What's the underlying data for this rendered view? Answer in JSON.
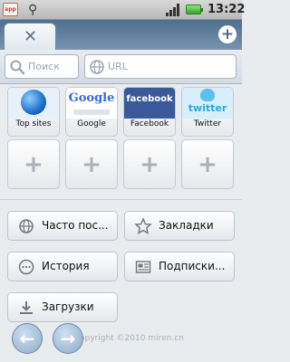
{
  "status_bar": {
    "app_icon_text": "app",
    "time": "13:22"
  },
  "tabs": {
    "close_glyph": "✕",
    "new_tab_glyph": "+"
  },
  "address_bar": {
    "search_placeholder": "Поиск",
    "url_placeholder": "URL"
  },
  "speed_dial": {
    "items": [
      {
        "label": "Top sites",
        "icon": "globe-icon"
      },
      {
        "label": "Google",
        "thumb_text": "Google"
      },
      {
        "label": "Facebook",
        "thumb_text": "facebook"
      },
      {
        "label": "Twitter",
        "thumb_text": "twitter"
      }
    ],
    "empty_slot_glyph": "+"
  },
  "menu": {
    "frequent": "Часто пос...",
    "bookmarks": "Закладки",
    "history": "История",
    "subscriptions": "Подписки...",
    "downloads": "Загрузки"
  },
  "footer": {
    "copyright": "opyright ©2010 miren.cn"
  },
  "colors": {
    "tab_strip": "#5f7d9b",
    "background": "#e9ecef",
    "battery": "#35a82a"
  }
}
